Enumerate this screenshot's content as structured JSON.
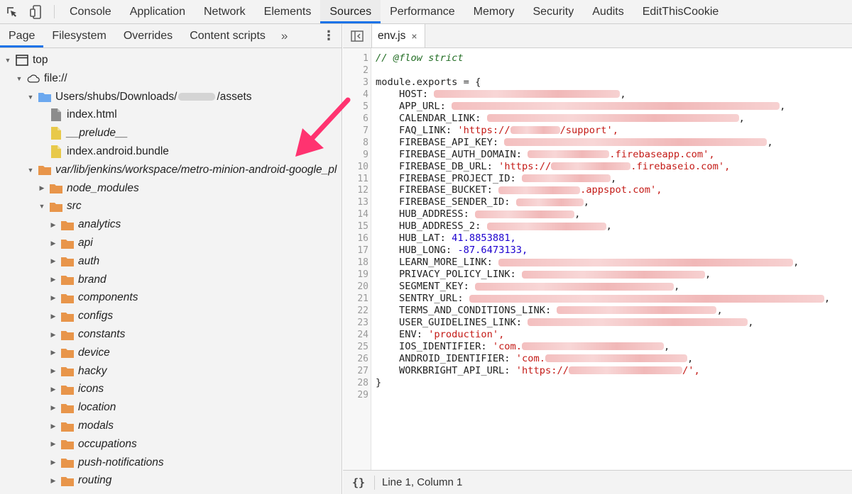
{
  "topbar": {
    "tabs": [
      "Console",
      "Application",
      "Network",
      "Elements",
      "Sources",
      "Performance",
      "Memory",
      "Security",
      "Audits",
      "EditThisCookie"
    ],
    "active_tab": "Sources"
  },
  "navigator": {
    "tabs": [
      "Page",
      "Filesystem",
      "Overrides",
      "Content scripts"
    ],
    "active_tab": "Page",
    "more": "»",
    "menu": "⋮"
  },
  "tree": {
    "top": "top",
    "file_origin": "file://",
    "assets_prefix": "Users/shubs/Downloads/",
    "assets_suffix": "/assets",
    "files": [
      "index.html",
      "__prelude__",
      "index.android.bundle"
    ],
    "jenkins_path": "var/lib/jenkins/workspace/metro-minion-android-google_pl",
    "node_modules": "node_modules",
    "src": "src",
    "src_folders": [
      "analytics",
      "api",
      "auth",
      "brand",
      "components",
      "configs",
      "constants",
      "device",
      "hacky",
      "icons",
      "location",
      "modals",
      "occupations",
      "push-notifications",
      "routing"
    ]
  },
  "editor": {
    "open_file": "env.js",
    "close_symbol": "×",
    "status_braces": "{}",
    "cursor_position": "Line 1, Column 1",
    "line_numbers": [
      "1",
      "2",
      "3",
      "4",
      "5",
      "6",
      "7",
      "8",
      "9",
      "10",
      "11",
      "12",
      "13",
      "14",
      "15",
      "16",
      "17",
      "18",
      "19",
      "20",
      "21",
      "22",
      "23",
      "24",
      "25",
      "26",
      "27",
      "28",
      "29"
    ],
    "comment": "// @flow strict",
    "module_open": "module.exports = {",
    "module_close": "}",
    "keys": [
      "HOST:",
      "APP_URL:",
      "CALENDAR_LINK:",
      "FAQ_LINK:",
      "FIREBASE_API_KEY:",
      "FIREBASE_AUTH_DOMAIN:",
      "FIREBASE_DB_URL:",
      "FIREBASE_PROJECT_ID:",
      "FIREBASE_BUCKET:",
      "FIREBASE_SENDER_ID:",
      "HUB_ADDRESS:",
      "HUB_ADDRESS_2:",
      "HUB_LAT:",
      "HUB_LONG:",
      "LEARN_MORE_LINK:",
      "PRIVACY_POLICY_LINK:",
      "SEGMENT_KEY:",
      "SENTRY_URL:",
      "TERMS_AND_CONDITIONS_LINK:",
      "USER_GUIDELINES_LINK:",
      "ENV:",
      "IOS_IDENTIFIER:",
      "ANDROID_IDENTIFIER:",
      "WORKBRIGHT_API_URL:"
    ],
    "faq_prefix": "'https://",
    "faq_suffix": "/support',",
    "auth_domain_suffix": ".firebaseapp.com',",
    "db_url_prefix": "'https://",
    "db_url_suffix": ".firebaseio.com',",
    "bucket_suffix": ".appspot.com',",
    "hub_lat": "41.8853881,",
    "hub_long": "-87.6473133,",
    "env_value": "'production',",
    "ios_prefix": "'com.",
    "android_prefix": "'com.",
    "workbright_prefix": "'https://",
    "workbright_suffix": "/',"
  },
  "colors": {
    "accent": "#1a73e8",
    "folder": "#e8954a",
    "folder_blue": "#6ba8ef",
    "arrow": "#ff3370",
    "string": "#c41a16",
    "comment": "#236e25",
    "number": "#1c00cf"
  }
}
